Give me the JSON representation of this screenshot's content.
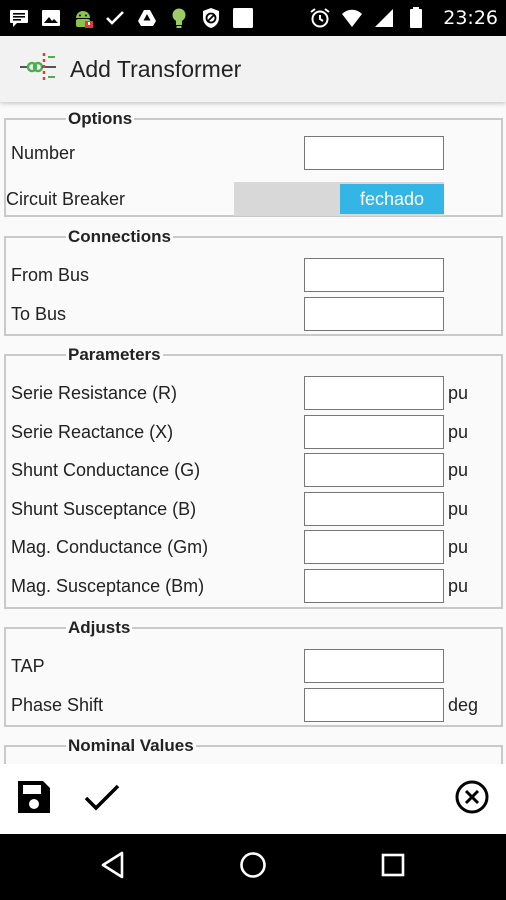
{
  "status_bar": {
    "time": "23:26",
    "left_icons": [
      "message-icon",
      "image-icon",
      "android-icon",
      "check-icon",
      "drive-icon",
      "bulb-icon",
      "blocked-icon",
      "square-icon"
    ],
    "right_icons": [
      "alarm-icon",
      "wifi-icon",
      "signal-icon",
      "battery-icon"
    ]
  },
  "app_bar": {
    "title": "Add Transformer",
    "icon": "transformer-logo-icon"
  },
  "sections": {
    "options": {
      "legend": "Options",
      "number_label": "Number",
      "number_value": "",
      "breaker_label": "Circuit Breaker",
      "breaker_state": "fechado"
    },
    "connections": {
      "legend": "Connections",
      "from_bus_label": "From Bus",
      "from_bus_value": "",
      "to_bus_label": "To Bus",
      "to_bus_value": ""
    },
    "parameters": {
      "legend": "Parameters",
      "unit": "pu",
      "r_label": "Serie Resistance (R)",
      "x_label": "Serie Reactance (X)",
      "g_label": "Shunt Conductance (G)",
      "b_label": "Shunt Susceptance (B)",
      "gm_label": "Mag. Conductance (Gm)",
      "bm_label": "Mag. Susceptance (Bm)"
    },
    "adjusts": {
      "legend": "Adjusts",
      "tap_label": "TAP",
      "phase_label": "Phase Shift",
      "phase_unit": "deg"
    },
    "nominal": {
      "legend": "Nominal Values"
    }
  },
  "bottom_bar": {
    "icons": [
      "save-icon",
      "check-icon",
      "cancel-icon"
    ]
  },
  "nav_bar": {
    "icons": [
      "back-icon",
      "home-icon",
      "recents-icon"
    ]
  },
  "colors": {
    "toggle_on": "#33b5e5",
    "app_bar_bg": "#f2f2f2"
  }
}
